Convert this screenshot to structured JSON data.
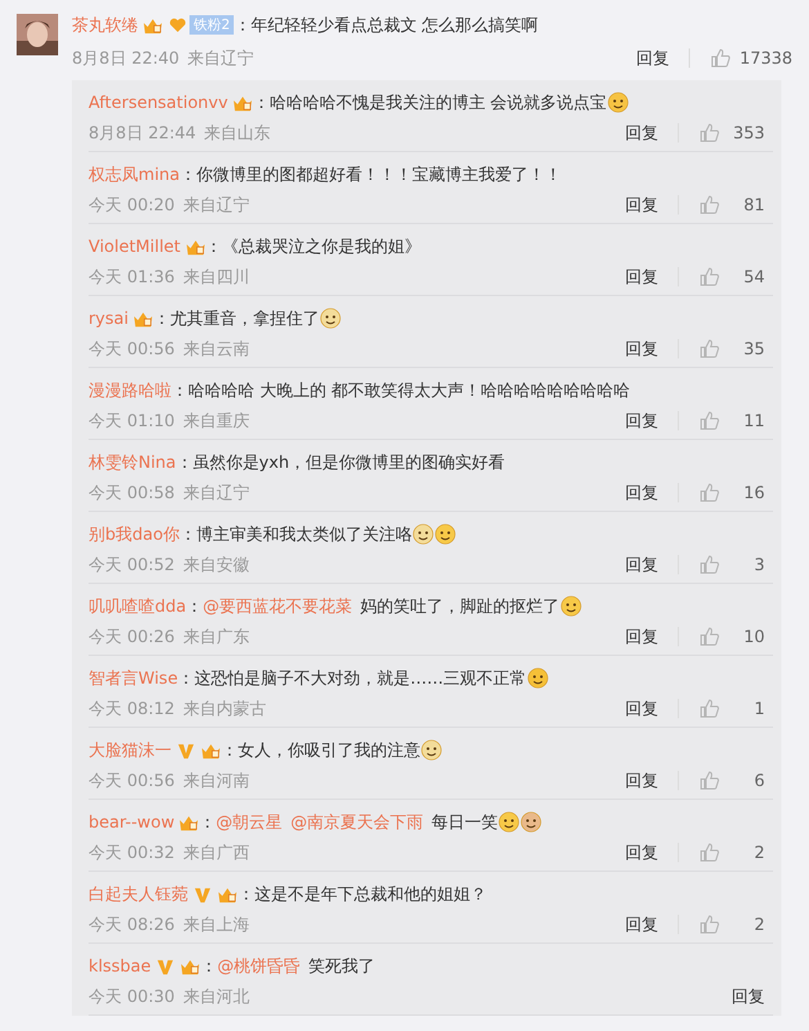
{
  "comment": {
    "user": "茶丸软绻",
    "badges": [
      {
        "kind": "member"
      },
      {
        "kind": "fan",
        "label": "铁粉2"
      }
    ],
    "separator": "：",
    "text": "年纪轻轻少看点总裁文  怎么那么搞笑啊",
    "date": "8月8日 22:40",
    "source": "来自辽宁",
    "reply_label": "回复",
    "likes": "17338"
  },
  "replies": [
    {
      "user": "Aftersensationvv",
      "badges": [
        {
          "kind": "member"
        }
      ],
      "separator": "：",
      "text": "哈哈哈哈不愧是我关注的博主  会说就多说点宝",
      "emojis": [
        {
          "kind": "grin"
        }
      ],
      "date": "8月8日 22:44",
      "source": "来自山东",
      "reply_label": "回复",
      "likes": "353"
    },
    {
      "user": "权志凤mina",
      "separator": "：",
      "text": "你微博里的图都超好看！！！宝藏博主我爱了！！",
      "date": "今天 00:20",
      "source": "来自辽宁",
      "reply_label": "回复",
      "likes": "81"
    },
    {
      "user": "VioletMillet",
      "badges": [
        {
          "kind": "member"
        }
      ],
      "separator": "：",
      "text": "《总裁哭泣之你是我的姐》",
      "date": "今天 01:36",
      "source": "来自四川",
      "reply_label": "回复",
      "likes": "54"
    },
    {
      "user": "rysai",
      "badges": [
        {
          "kind": "member"
        }
      ],
      "separator": "：",
      "text": "尤其重音，拿捏住了",
      "emojis": [
        {
          "kind": "doge"
        }
      ],
      "date": "今天 00:56",
      "source": "来自云南",
      "reply_label": "回复",
      "likes": "35"
    },
    {
      "user": "漫漫路哈啦",
      "separator": "：",
      "text": "哈哈哈哈  大晚上的  都不敢笑得太大声！哈哈哈哈哈哈哈哈哈",
      "date": "今天 01:10",
      "source": "来自重庆",
      "reply_label": "回复",
      "likes": "11"
    },
    {
      "user": "林雯铃Nina",
      "separator": "：",
      "text": "虽然你是yxh，但是你微博里的图确实好看",
      "date": "今天 00:58",
      "source": "来自辽宁",
      "reply_label": "回复",
      "likes": "16"
    },
    {
      "user": "别b我dao你",
      "separator": "：",
      "text": "博主审美和我太类似了关注咯",
      "emojis": [
        {
          "kind": "doge"
        },
        {
          "kind": "cry"
        }
      ],
      "date": "今天 00:52",
      "source": "来自安徽",
      "reply_label": "回复",
      "likes": "3"
    },
    {
      "user": "叽叽喳喳dda",
      "separator": "：",
      "mentions": [
        "@要西蓝花不要花菜"
      ],
      "text": "妈的笑吐了，脚趾的抠烂了",
      "emojis": [
        {
          "kind": "cry"
        }
      ],
      "date": "今天 00:26",
      "source": "来自广东",
      "reply_label": "回复",
      "likes": "10"
    },
    {
      "user": "智者言Wise",
      "separator": "：",
      "text": "这恐怕是脑子不大对劲，就是……三观不正常",
      "emojis": [
        {
          "kind": "laugh"
        }
      ],
      "date": "今天 08:12",
      "source": "来自内蒙古",
      "reply_label": "回复",
      "likes": "1"
    },
    {
      "user": "大脸猫沫一",
      "badges": [
        {
          "kind": "verified"
        },
        {
          "kind": "member"
        }
      ],
      "separator": "：",
      "text": "女人，你吸引了我的注意",
      "emojis": [
        {
          "kind": "doge"
        }
      ],
      "date": "今天 00:56",
      "source": "来自河南",
      "reply_label": "回复",
      "likes": "6"
    },
    {
      "user": "bear--wow",
      "badges": [
        {
          "kind": "member"
        }
      ],
      "separator": "：",
      "mentions": [
        "@朝云星",
        "@南京夏天会下雨"
      ],
      "text": "每日一笑",
      "emojis": [
        {
          "kind": "cry"
        },
        {
          "kind": "thumb"
        }
      ],
      "date": "今天 00:32",
      "source": "来自广西",
      "reply_label": "回复",
      "likes": "2"
    },
    {
      "user": "白起夫人钰菀",
      "badges": [
        {
          "kind": "verified"
        },
        {
          "kind": "member"
        }
      ],
      "separator": "：",
      "text": "这是不是年下总裁和他的姐姐？",
      "date": "今天 08:26",
      "source": "来自上海",
      "reply_label": "回复",
      "likes": "2"
    },
    {
      "user": "klssbae",
      "badges": [
        {
          "kind": "verified"
        },
        {
          "kind": "member"
        }
      ],
      "separator": "：",
      "mentions": [
        "@桃饼昏昏"
      ],
      "text": "笑死我了",
      "date": "今天 00:30",
      "source": "来自河北",
      "reply_label": "回复"
    }
  ]
}
